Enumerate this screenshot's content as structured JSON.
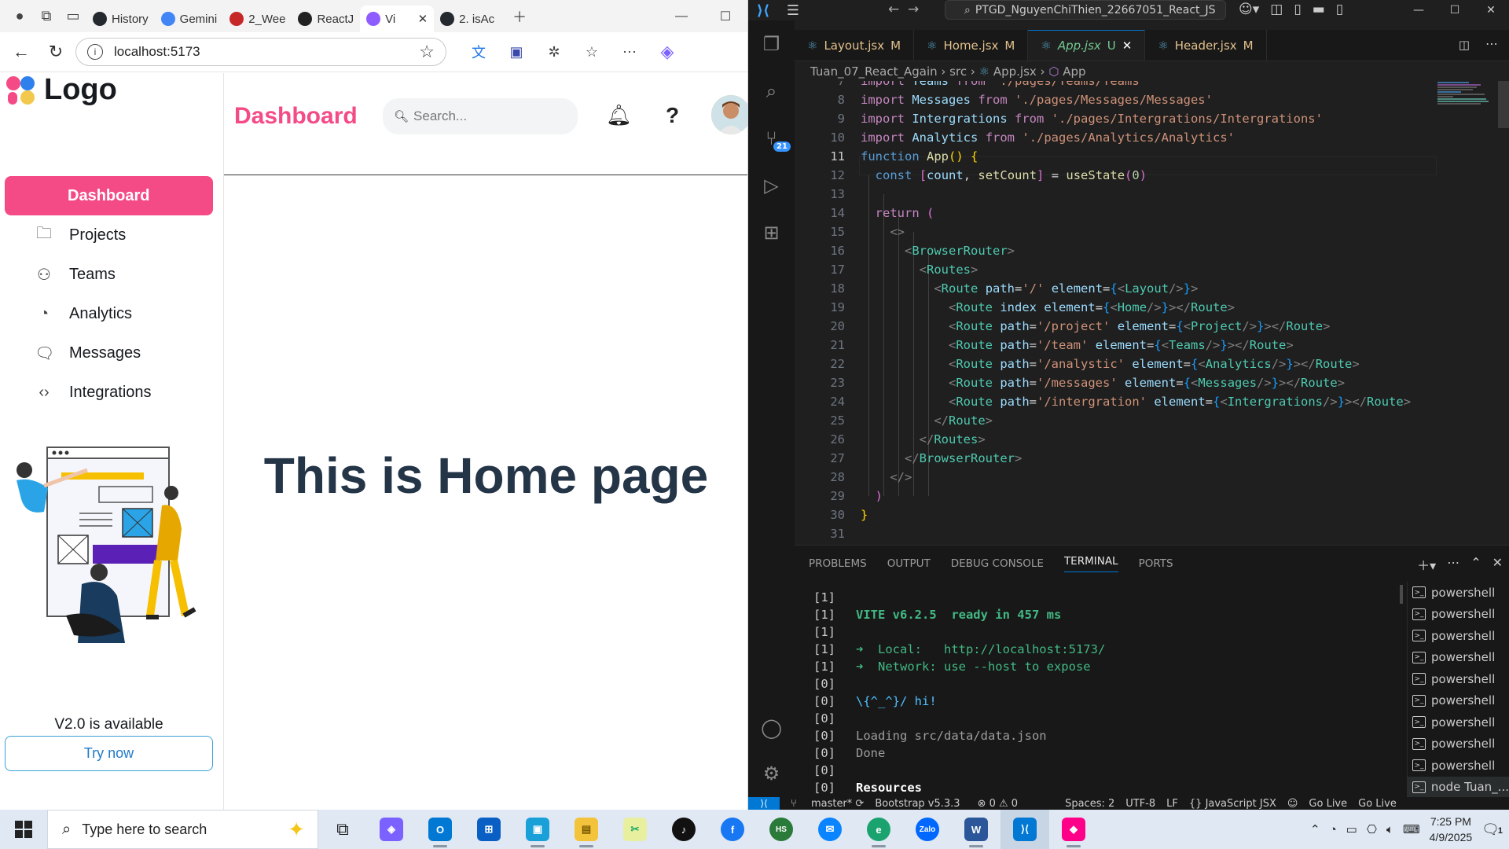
{
  "browser": {
    "tabs": [
      {
        "label": "History",
        "icon": "github-icon",
        "color": "#24292f"
      },
      {
        "label": "Gemini",
        "icon": "gemini-icon",
        "color": "#4285f4"
      },
      {
        "label": "2_Wee",
        "icon": "pdf-icon",
        "color": "#c62828"
      },
      {
        "label": "ReactJ",
        "icon": "chatgpt-icon",
        "color": "#222222"
      },
      {
        "label": "Vi",
        "icon": "vite-icon",
        "color": "#8f5cff"
      },
      {
        "label": "2. isAc",
        "icon": "github-icon",
        "color": "#24292f"
      }
    ],
    "active_tab_index": 4,
    "url": "localhost:5173"
  },
  "app": {
    "logo_text": "Logo",
    "page_title": "Dashboard",
    "search_placeholder": "Search...",
    "menu": [
      {
        "label": "Dashboard",
        "icon": "grid-icon",
        "active": true
      },
      {
        "label": "Projects",
        "icon": "folder-icon",
        "active": false
      },
      {
        "label": "Teams",
        "icon": "team-icon",
        "active": false
      },
      {
        "label": "Analytics",
        "icon": "pie-chart-icon",
        "active": false
      },
      {
        "label": "Messages",
        "icon": "message-icon",
        "active": false
      },
      {
        "label": "Integrations",
        "icon": "code-icon",
        "active": false
      }
    ],
    "promo_text": "V2.0 is available",
    "try_button": "Try now",
    "home_heading": "This is Home page",
    "accent_color": "#f44b87"
  },
  "vscode": {
    "command_center": "PTGD_NguyenChiThien_22667051_React_JS",
    "tabs": [
      {
        "label": "Layout.jsx",
        "status": "M"
      },
      {
        "label": "Home.jsx",
        "status": "M"
      },
      {
        "label": "App.jsx",
        "status": "U",
        "active": true
      },
      {
        "label": "Header.jsx",
        "status": "M"
      }
    ],
    "breadcrumb": [
      "Tuan_07_React_Again",
      "src",
      "App.jsx",
      "App"
    ],
    "line_numbers": [
      "7",
      "8",
      "9",
      "10",
      "11",
      "12",
      "13",
      "14",
      "15",
      "16",
      "17",
      "18",
      "19",
      "20",
      "21",
      "22",
      "23",
      "24",
      "25",
      "26",
      "27",
      "28",
      "29",
      "30",
      "31"
    ],
    "current_line": "11",
    "panel_tabs": [
      "PROBLEMS",
      "OUTPUT",
      "DEBUG CONSOLE",
      "TERMINAL",
      "PORTS"
    ],
    "active_panel_tab": "TERMINAL",
    "terminal_lines": [
      {
        "prefix": "[1]",
        "text": ""
      },
      {
        "prefix": "[1]",
        "text": "VITE v6.2.5  ready in 457 ms"
      },
      {
        "prefix": "[1]",
        "text": ""
      },
      {
        "prefix": "[1]",
        "text": "➜  Local:   http://localhost:5173/"
      },
      {
        "prefix": "[1]",
        "text": "➜  Network: use --host to expose"
      },
      {
        "prefix": "[0]",
        "text": ""
      },
      {
        "prefix": "[0]",
        "text": "\\{^_^}/ hi!"
      },
      {
        "prefix": "[0]",
        "text": ""
      },
      {
        "prefix": "[0]",
        "text": "Loading src/data/data.json"
      },
      {
        "prefix": "[0]",
        "text": "Done"
      },
      {
        "prefix": "[0]",
        "text": ""
      },
      {
        "prefix": "[0]",
        "text": "Resources"
      }
    ],
    "terminal_list": [
      "powershell",
      "powershell",
      "powershell",
      "powershell",
      "powershell",
      "powershell",
      "powershell",
      "powershell",
      "powershell",
      "node  Tuan_..."
    ],
    "status": {
      "branch": "master*",
      "bootstrap": "Bootstrap v5.3.3",
      "problems": "⊗ 0 ⚠ 0",
      "spaces": "Spaces: 2",
      "encoding": "UTF-8",
      "eol": "LF",
      "language": "{} JavaScript JSX",
      "golive1": "Go Live",
      "golive2": "Go Live"
    }
  },
  "taskbar": {
    "search_placeholder": "Type here to search",
    "time": "7:25 PM",
    "date": "4/9/2025",
    "notifications": "1"
  }
}
